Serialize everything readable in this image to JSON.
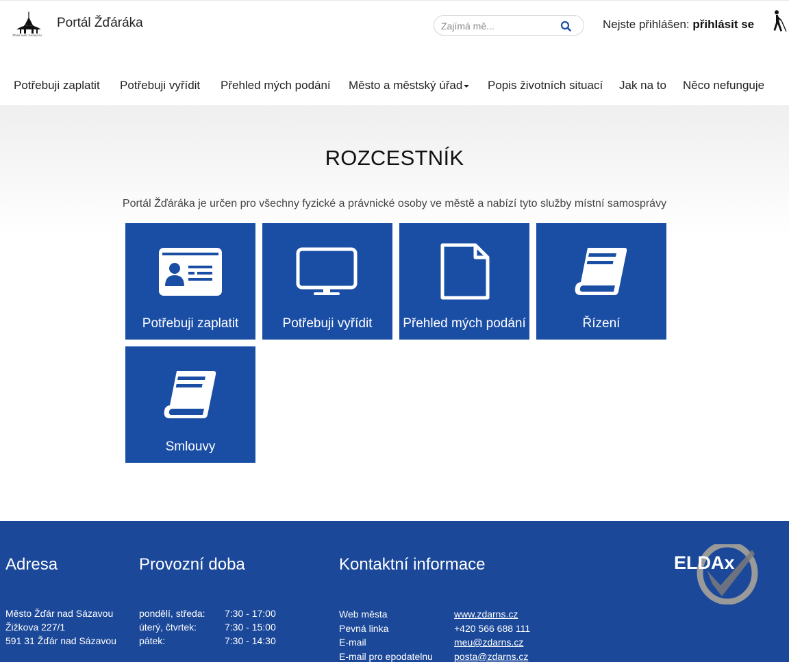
{
  "header": {
    "logo_text": "ŽĎÁR NAD SÁZAVOU",
    "title": "Portál Žďáráka",
    "search_placeholder": "Zajímá mě...",
    "login_prefix": "Nejste přihlášen:",
    "login_link": "přihlásit se",
    "accent_color": "#1a4ea5"
  },
  "nav": {
    "items": [
      {
        "label": "Potřebuji zaplatit"
      },
      {
        "label": "Potřebuji vyřídit"
      },
      {
        "label": "Přehled mých podání"
      },
      {
        "label": "Město a městský úřad",
        "dropdown": true
      },
      {
        "label": "Popis životních situací"
      },
      {
        "label": "Jak na to"
      },
      {
        "label": "Něco nefunguje"
      }
    ]
  },
  "main": {
    "title": "ROZCESTNÍK",
    "subtitle": "Portál Žďáráka je určen pro všechny fyzické a právnické osoby ve městě a nabízí tyto služby místní samosprávy",
    "tiles": [
      {
        "label": "Potřebuji zaplatit",
        "icon": "id-card-icon"
      },
      {
        "label": "Potřebuji vyřídit",
        "icon": "monitor-icon"
      },
      {
        "label": "Přehled mých podání",
        "icon": "document-icon"
      },
      {
        "label": "Řízení",
        "icon": "book-icon"
      },
      {
        "label": "Smlouvy",
        "icon": "book-icon"
      }
    ]
  },
  "footer": {
    "address": {
      "heading": "Adresa",
      "lines": [
        "Město Žďár nad Sázavou",
        "Žižkova 227/1",
        "591 31 Žďár nad Sázavou"
      ]
    },
    "hours": {
      "heading": "Provozní doba",
      "rows": [
        {
          "days": "pondělí, středa:",
          "time": "7:30 - 17:00"
        },
        {
          "days": "úterý, čtvrtek:",
          "time": "7:30 - 15:00"
        },
        {
          "days": "pátek:",
          "time": "7:30 - 14:30"
        }
      ]
    },
    "contact": {
      "heading": "Kontaktní informace",
      "rows": [
        {
          "label": "Web města",
          "value": "www.zdarns.cz"
        },
        {
          "label": "Pevná linka",
          "value": "+420 566 688 111"
        },
        {
          "label": "E-mail",
          "value": "meu@zdarns.cz"
        },
        {
          "label": "E-mail pro epodatelnu",
          "value": "posta@zdarns.cz"
        }
      ]
    },
    "brand": "ELDAx",
    "background_color": "#1b4899"
  }
}
